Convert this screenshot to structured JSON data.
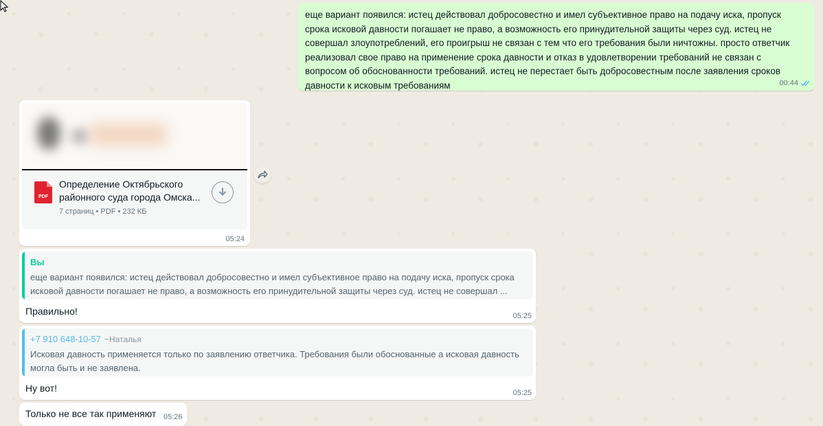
{
  "messages": {
    "out1": {
      "text": "еще вариант появился: истец действовал добросовестно и имел субъективное право на подачу иска,  пропуск срока исковой давности погашает не право, а возможность его принудительной защиты через суд. истец не совершал злоупотреблений, его проигрыш не связан с тем что его требования были ничтожны. просто ответчик реализовал свое право на применение срока давности и отказ в удовлетворении требований не связан с вопросом об обоснованности требований. истец не перестает быть добросовестным после заявления сроков давности к исковым требованиям",
      "time": "00:44",
      "status": "read"
    },
    "doc": {
      "title_line1": "Определение Октябрьского",
      "title_line2": "районного суда города Омска...",
      "meta": "7 страниц • PDF • 232 КБ",
      "file_type": "PDF",
      "time": "05:24"
    },
    "reply1": {
      "quote_author": "Вы",
      "quote_line1": "еще вариант появился: истец действовал добросовестно и имел субъективное право на подачу иска,  пропуск срока",
      "quote_line2": "исковой давности погашает не право, а возможность его принудительной защиты через суд. истец не совершал ...",
      "text": "Правильно!",
      "time": "05:25"
    },
    "reply2": {
      "quote_author": "+7 910 648-10-57",
      "quote_author_name": "~Наталья",
      "quote_line1": "Исковая давность применяется только по заявлению ответчика. Требования были обоснованные а исковая давность",
      "quote_line2": "могла быть и не заявлена.",
      "text": "Ну вот!",
      "time": "05:25"
    },
    "last": {
      "text": "Только не все так применяют",
      "time": "05:26"
    }
  },
  "colors": {
    "outgoing_bubble": "#d9fdd3",
    "incoming_bubble": "#ffffff",
    "self_quote_bar": "#06cf9c",
    "other_quote_bar": "#53bdeb",
    "read_ticks": "#53bdeb",
    "pdf_red": "#e0232e"
  },
  "icons": [
    "forward-icon",
    "download-icon",
    "pdf-icon",
    "double-check-icon",
    "cursor-icon"
  ]
}
